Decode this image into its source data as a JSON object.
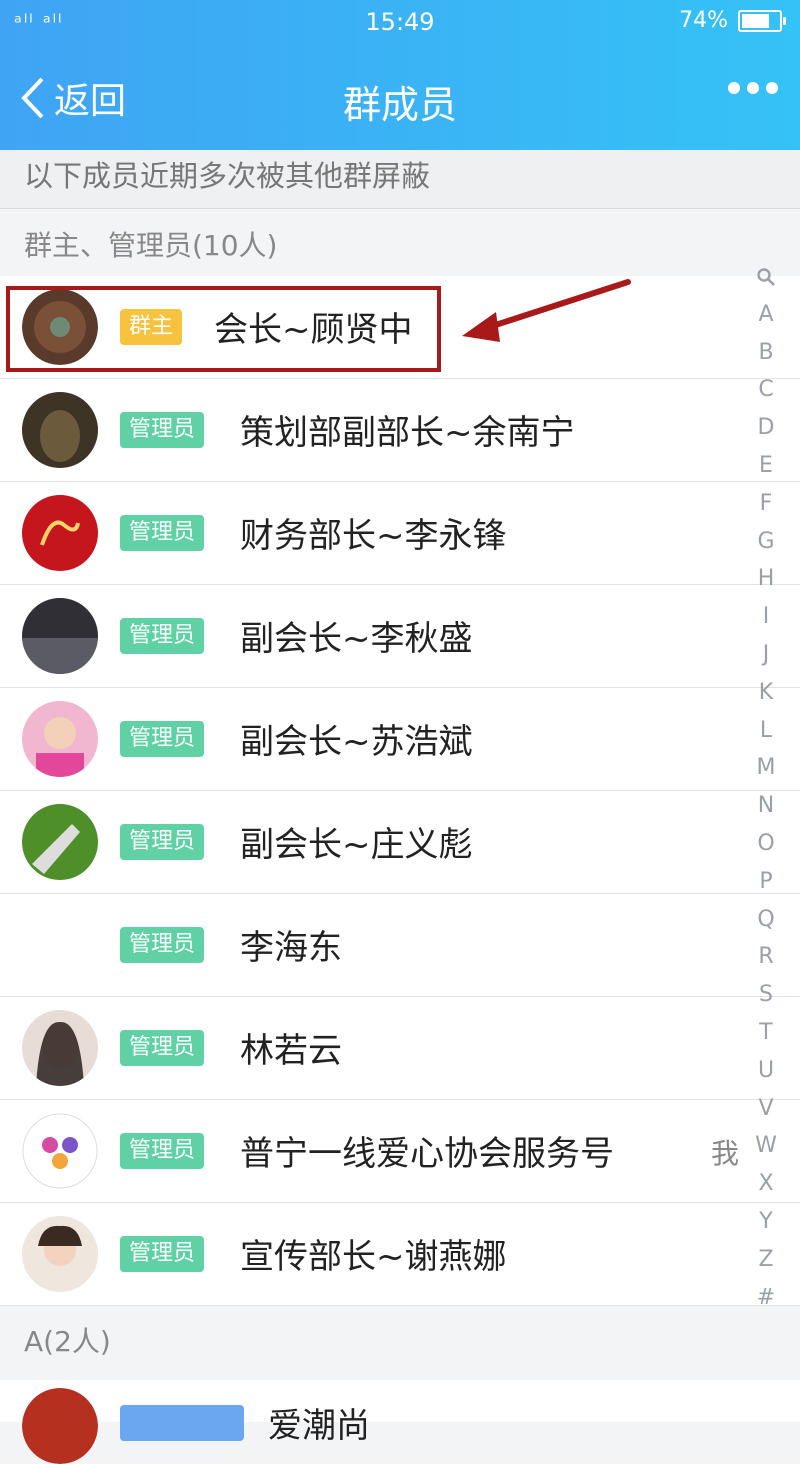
{
  "status_bar": {
    "signal": "ᵃˡˡ ᵃˡˡ",
    "time": "15:49",
    "battery": "74%",
    "battery_level": 0.74
  },
  "nav": {
    "back_label": "返回",
    "title": "群成员"
  },
  "notice": "以下成员近期多次被其他群屏蔽",
  "section_admins": "群主、管理员(10人)",
  "members": [
    {
      "role": "群主",
      "name": "会长~顾贤中"
    },
    {
      "role": "管理员",
      "name": "策划部副部长~余南宁"
    },
    {
      "role": "管理员",
      "name": "财务部长~李永锋"
    },
    {
      "role": "管理员",
      "name": "副会长~李秋盛"
    },
    {
      "role": "管理员",
      "name": "副会长~苏浩斌"
    },
    {
      "role": "管理员",
      "name": "副会长~庄义彪"
    },
    {
      "role": "管理员",
      "name": "李海东"
    },
    {
      "role": "管理员",
      "name": "林若云"
    },
    {
      "role": "管理员",
      "name": "普宁一线爱心协会服务号",
      "me": "我"
    },
    {
      "role": "管理员",
      "name": "宣传部长~谢燕娜"
    }
  ],
  "section_a": "A(2人)",
  "partial_member": {
    "name": "爱潮尚"
  },
  "index_letters": [
    "A",
    "B",
    "C",
    "D",
    "E",
    "F",
    "G",
    "H",
    "I",
    "J",
    "K",
    "L",
    "M",
    "N",
    "O",
    "P",
    "Q",
    "R",
    "S",
    "T",
    "U",
    "V",
    "W",
    "X",
    "Y",
    "Z",
    "#"
  ],
  "colors": {
    "header": "#3fa4f4",
    "owner_badge": "#f7c23d",
    "admin_badge": "#5fd1a4",
    "highlight": "#a8191a"
  }
}
